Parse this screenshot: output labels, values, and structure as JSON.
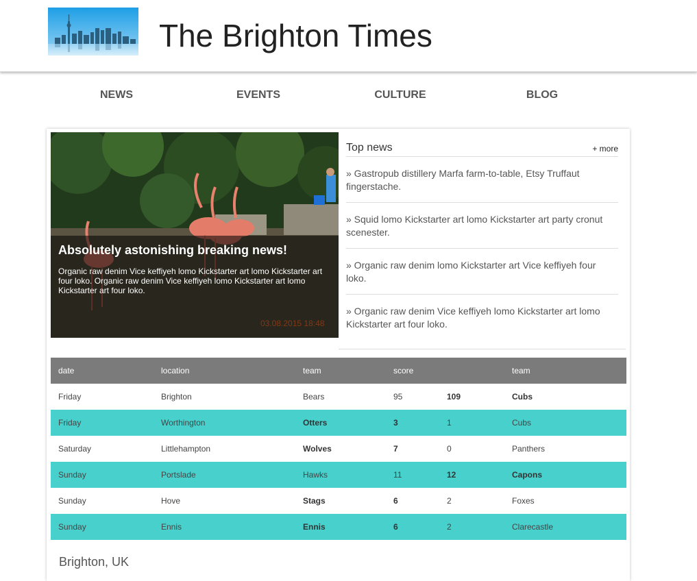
{
  "site": {
    "title": "The Brighton Times"
  },
  "nav": {
    "items": [
      "NEWS",
      "EVENTS",
      "CULTURE",
      "BLOG"
    ]
  },
  "hero": {
    "title": "Absolutely astonishing breaking news!",
    "text": "Organic raw denim Vice keffiyeh lomo Kickstarter art lomo Kickstarter art four loko. Organic raw denim Vice keffiyeh lomo Kickstarter art lomo Kickstarter art four loko.",
    "stamp": "03.08.2015 18:48"
  },
  "topnews": {
    "title": "Top news",
    "more": "+ more",
    "items": [
      "» Gastropub distillery Marfa farm-to-table, Etsy Truffaut fingerstache.",
      "» Squid lomo Kickstarter art lomo Kickstarter art party cronut scenester.",
      "» Organic raw denim lomo Kickstarter art Vice keffiyeh four loko.",
      "» Organic raw denim Vice keffiyeh lomo Kickstarter art lomo Kickstarter art four loko."
    ]
  },
  "table": {
    "headers": [
      "date",
      "location",
      "team",
      "score",
      "",
      "team"
    ],
    "rows": [
      [
        "Friday",
        "Brighton",
        "Bears",
        "95",
        "109",
        "Cubs"
      ],
      [
        "Friday",
        "Worthington",
        "Otters",
        "3",
        "1",
        "Cubs"
      ],
      [
        "Saturday",
        "Littlehampton",
        "Wolves",
        "7",
        "0",
        "Panthers"
      ],
      [
        "Sunday",
        "Portslade",
        "Hawks",
        "11",
        "12",
        "Capons"
      ],
      [
        "Sunday",
        "Hove",
        "Stags",
        "6",
        "2",
        "Foxes"
      ],
      [
        "Sunday",
        "Ennis",
        "Ennis",
        "6",
        "2",
        "Clarecastle"
      ]
    ]
  },
  "location": {
    "label": "Brighton, UK"
  },
  "colors": {
    "accent_row": "#48d0cc",
    "table_header": "#7b7b7b"
  }
}
